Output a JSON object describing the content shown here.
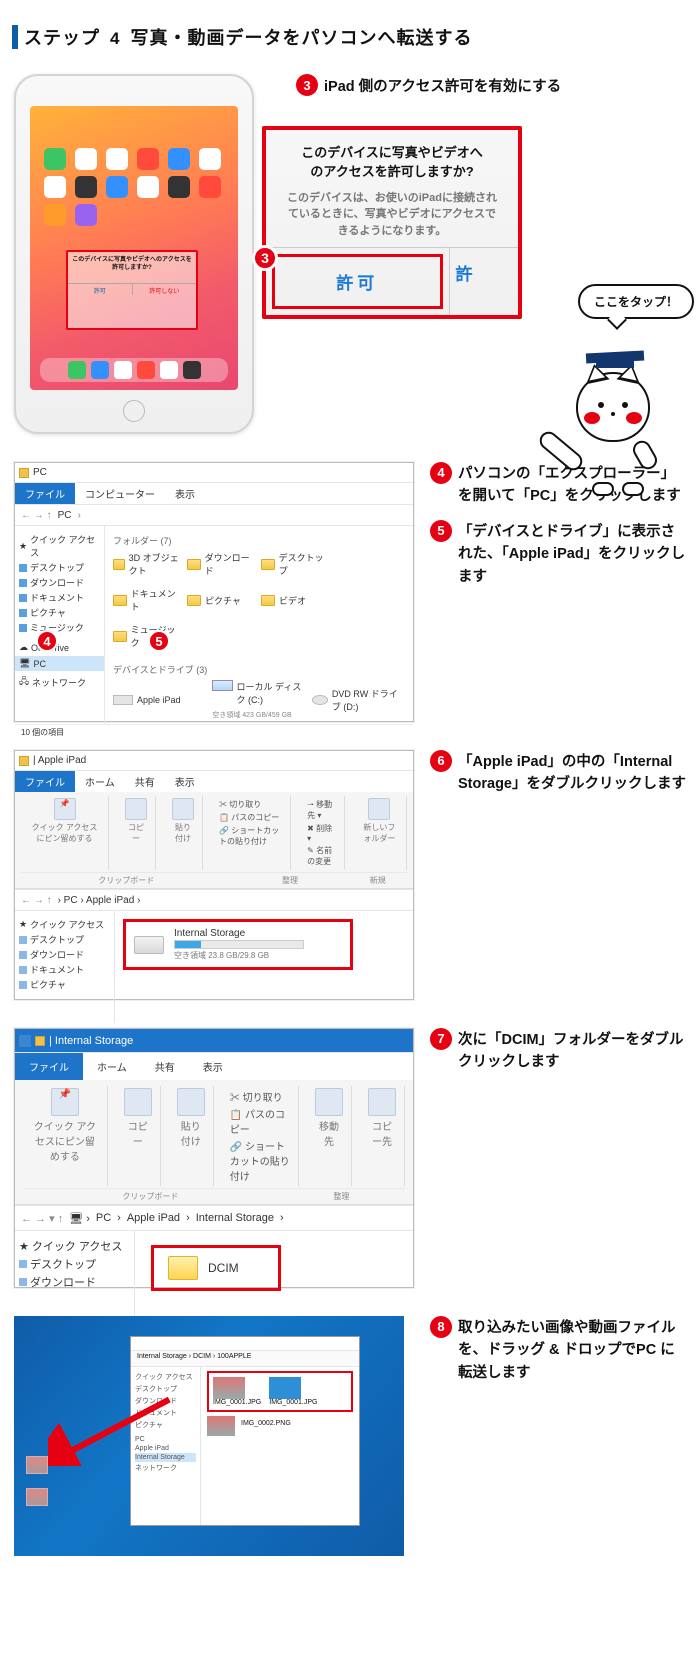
{
  "step_header": {
    "prefix": "ステップ",
    "num": "4",
    "title": "写真・動画データをパソコンへ転送する"
  },
  "instr3": {
    "num": "3",
    "text": "iPad 側のアクセス許可を有効にする"
  },
  "popup": {
    "title_l1": "このデバイスに写真やビデオへ",
    "title_l2": "のアクセスを許可しますか?",
    "body": "このデバイスは、お使いのiPadに接続されているときに、写真やビデオにアクセスできるようになります。",
    "allow": "許可",
    "allow_cut": "許"
  },
  "callout": {
    "title": "このデバイスに写真やビデオへのアクセスを許可しますか?",
    "btn_left": "許可",
    "btn_right": "許可しない"
  },
  "bubble": "ここをタップ！",
  "instr4": {
    "num": "4",
    "text": "パソコンの「エクスプローラー」を開いて「PC」をクリックします"
  },
  "instr5": {
    "num": "5",
    "text": "「デバイスとドライブ」に表示された、「Apple iPad」をクリックします"
  },
  "explorer1": {
    "title": "PC",
    "file_tab": "ファイル",
    "tab2": "コンピューター",
    "tab3": "表示",
    "addr": "PC",
    "side_quick": "クイック アクセス",
    "side_desktop": "デスクトップ",
    "side_download": "ダウンロード",
    "side_document": "ドキュメント",
    "side_picture": "ピクチャ",
    "side_music": "ミュージック",
    "side_onedrive": "OneDrive",
    "side_pc": "PC",
    "side_network": "ネットワーク",
    "sec_folders": "フォルダー (7)",
    "f_3d": "3D オブジェクト",
    "f_dl": "ダウンロード",
    "f_desk": "デスクトップ",
    "f_doc": "ドキュメント",
    "f_pic": "ピクチャ",
    "f_vid": "ビデオ",
    "f_music": "ミュージック",
    "sec_devices": "デバイスとドライブ (3)",
    "d_ipad": "Apple iPad",
    "d_c": "ローカル ディスク (C:)",
    "d_c_sub": "空き領域 423 GB/459 GB",
    "d_dvd": "DVD RW ドライブ (D:)",
    "foot": "10 個の項目"
  },
  "instr6": {
    "num": "6",
    "text": "「Apple iPad」の中の「Internal Storage」をダブルクリックします"
  },
  "explorer2": {
    "title": "Apple iPad",
    "t_file": "ファイル",
    "t_home": "ホーム",
    "t_share": "共有",
    "t_view": "表示",
    "r_pin": "クイック アクセスにピン留めする",
    "r_copy": "コピー",
    "r_paste": "貼り付け",
    "r_cut": "切り取り",
    "r_path": "パスのコピー",
    "r_sc": "ショートカットの貼り付け",
    "r_move": "移動先",
    "r_del": "削除",
    "r_rename": "名前の変更",
    "r_new": "新しいフォルダー",
    "grp_clip": "クリップボード",
    "grp_org": "整理",
    "grp_new": "新規",
    "addr1": "PC",
    "addr2": "Apple iPad",
    "side_quick": "クイック アクセス",
    "side_desktop": "デスクトップ",
    "side_download": "ダウンロード",
    "side_document": "ドキュメント",
    "side_picture": "ピクチャ",
    "drive_name": "Internal Storage",
    "drive_free": "空き領域 23.8 GB/29.8 GB"
  },
  "instr7": {
    "num": "7",
    "text": "次に「DCIM」フォルダーをダブルクリックします"
  },
  "explorer3": {
    "title": "Internal Storage",
    "t_file": "ファイル",
    "t_home": "ホーム",
    "t_share": "共有",
    "t_view": "表示",
    "r_pin": "クイック アクセスにピン留めする",
    "r_copy": "コピー",
    "r_paste": "貼り付け",
    "r_cut": "切り取り",
    "r_path": "パスのコピー",
    "r_sc": "ショートカットの貼り付け",
    "r_move": "移動先",
    "r_copyto": "コピー先",
    "grp_clip": "クリップボード",
    "grp_org": "整理",
    "addr1": "PC",
    "addr2": "Apple iPad",
    "addr3": "Internal Storage",
    "side_quick": "クイック アクセス",
    "side_desktop": "デスクトップ",
    "side_download": "ダウンロード",
    "dcim": "DCIM"
  },
  "instr8": {
    "num": "8",
    "text": "取り込みたい画像や動画ファイルを、ドラッグ & ドロップでPC に転送します"
  },
  "desktop": {
    "addr": "Internal Storage › DCIM › 100APPLE",
    "side": [
      "クイック アクセス",
      "デスクトップ",
      "ダウンロード",
      "ドキュメント",
      "ピクチャ",
      "PC",
      "Apple iPad",
      "Internal Storage",
      "ネットワーク"
    ],
    "file1": "IMG_0001.JPG",
    "file2": "IMG_0001.JPG",
    "file3": "IMG_0002.PNG"
  }
}
